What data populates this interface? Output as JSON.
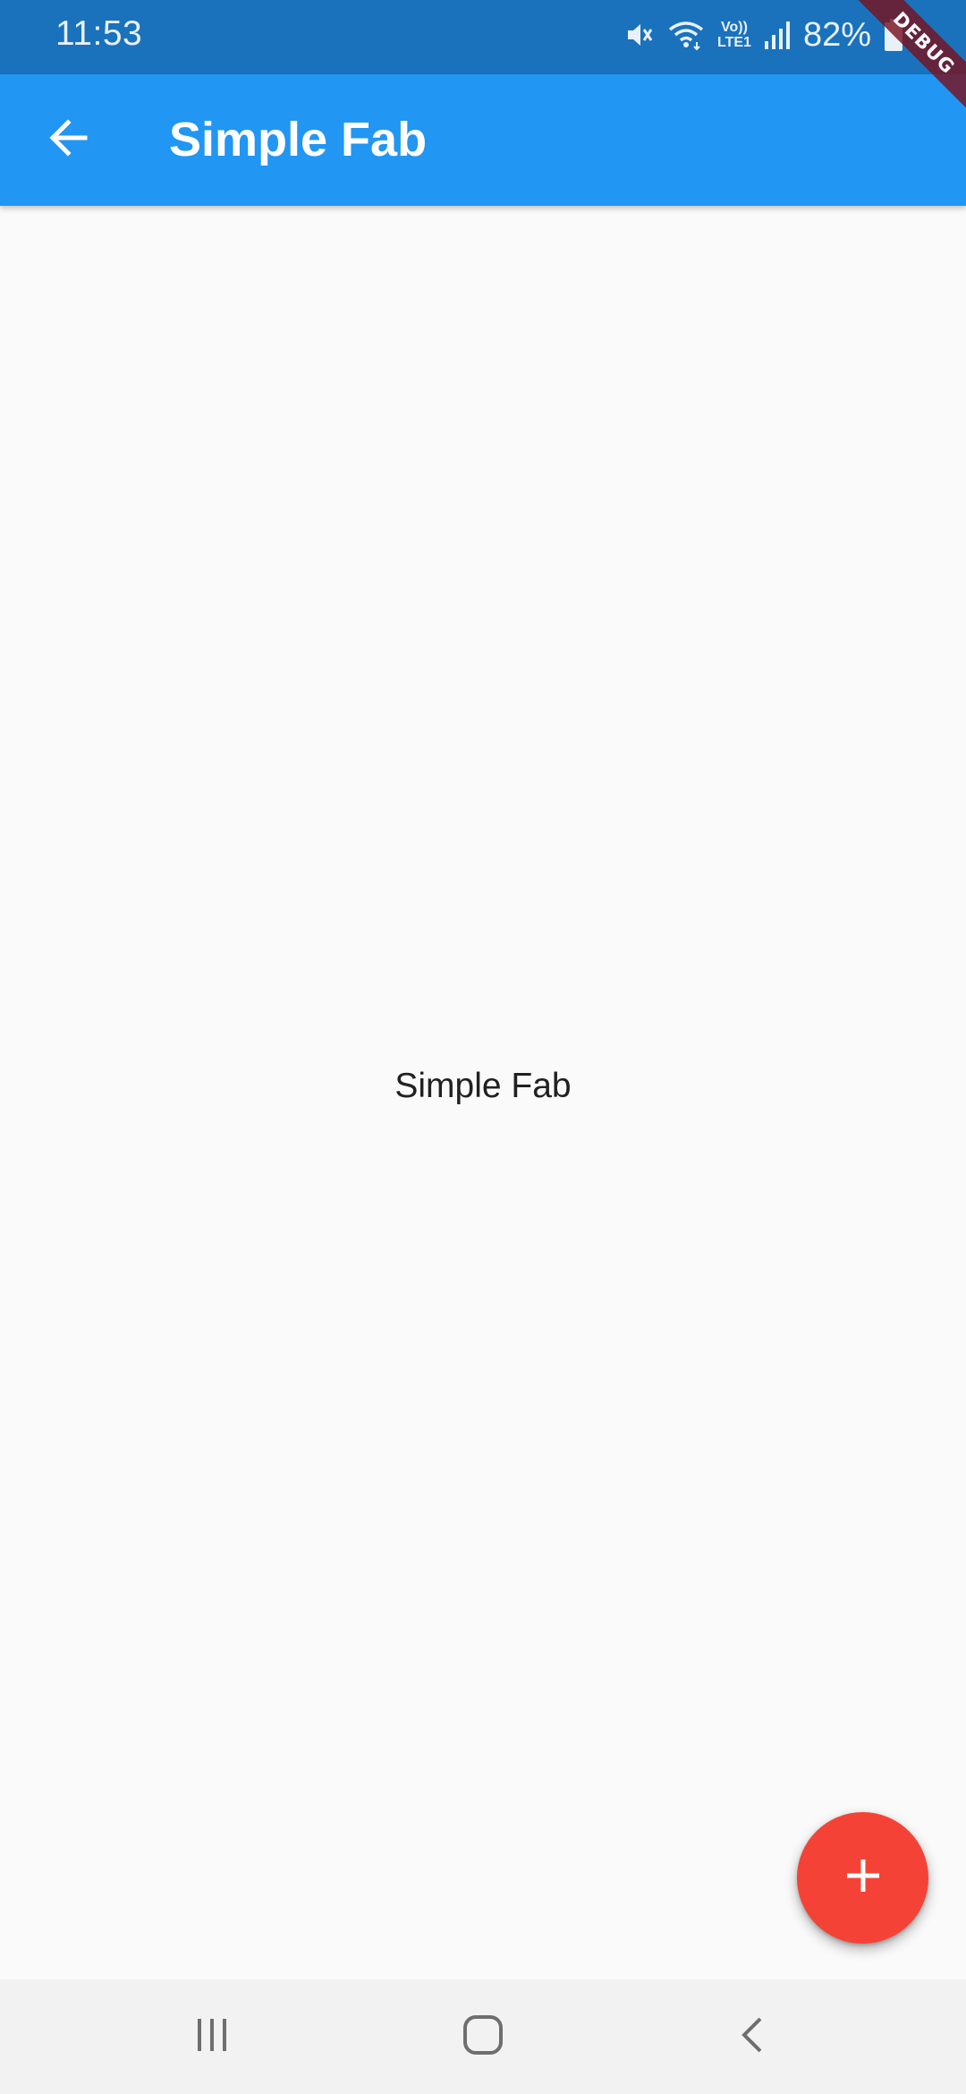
{
  "status_bar": {
    "time": "11:53",
    "battery_percent": "82%",
    "network_label_top": "Vo))",
    "network_label_bottom": "LTE1",
    "icons": [
      "mute-icon",
      "wifi-icon",
      "volte-icon",
      "signal-icon",
      "battery-icon"
    ]
  },
  "debug_banner": {
    "label": "DEBUG"
  },
  "app_bar": {
    "title": "Simple Fab",
    "back_icon": "arrow-back-icon",
    "background_color": "#2196f3"
  },
  "body": {
    "center_text": "Simple Fab"
  },
  "fab": {
    "icon": "add-icon",
    "background_color": "#f44336"
  },
  "nav_bar": {
    "buttons": [
      {
        "icon": "recents-icon"
      },
      {
        "icon": "home-icon"
      },
      {
        "icon": "back-icon"
      }
    ]
  }
}
